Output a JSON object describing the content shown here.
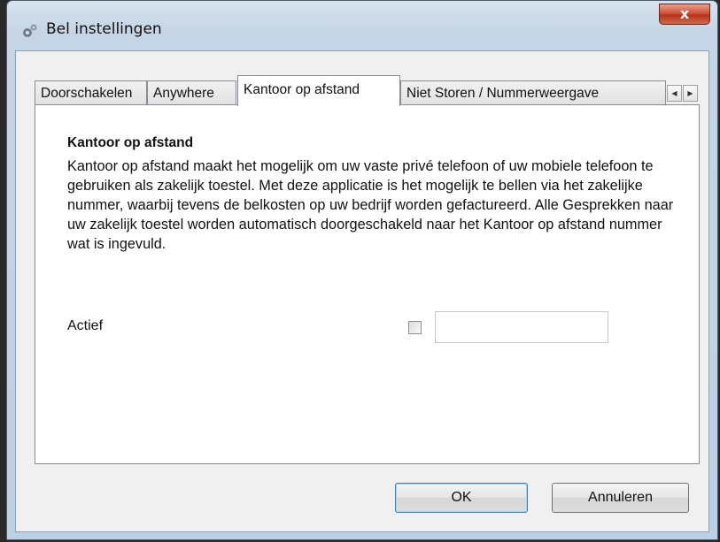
{
  "window": {
    "title": "Bel instellingen",
    "close_label": "x"
  },
  "tabs": [
    {
      "label": "Doorschakelen",
      "active": false
    },
    {
      "label": "Anywhere",
      "active": false
    },
    {
      "label": "Kantoor op afstand",
      "active": true
    },
    {
      "label": "Niet Storen / Nummerweergave",
      "active": false
    }
  ],
  "tab_scroll": {
    "left": "◀",
    "right": "▶"
  },
  "panel": {
    "heading": "Kantoor op afstand",
    "description": "Kantoor op afstand maakt het mogelijk om uw vaste privé telefoon of uw mobiele telefoon te gebruiken als zakelijk toestel. Met deze applicatie is het mogelijk te bellen via het zakelijke nummer, waarbij tevens de belkosten op uw bedrijf worden gefactureerd. Alle Gesprekken naar uw zakelijk toestel worden automatisch doorgeschakeld naar het Kantoor op afstand nummer wat is ingevuld.",
    "actief_label": "Actief",
    "actief_checked": false,
    "number_value": ""
  },
  "buttons": {
    "ok": "OK",
    "cancel": "Annuleren"
  },
  "icons": {
    "app": "gears-icon",
    "close": "close-icon"
  },
  "colors": {
    "title_gradient_top": "#d7e3ef",
    "close_red": "#c7432a",
    "panel_bg": "#ffffff",
    "client_bg": "#f0f0f0"
  }
}
